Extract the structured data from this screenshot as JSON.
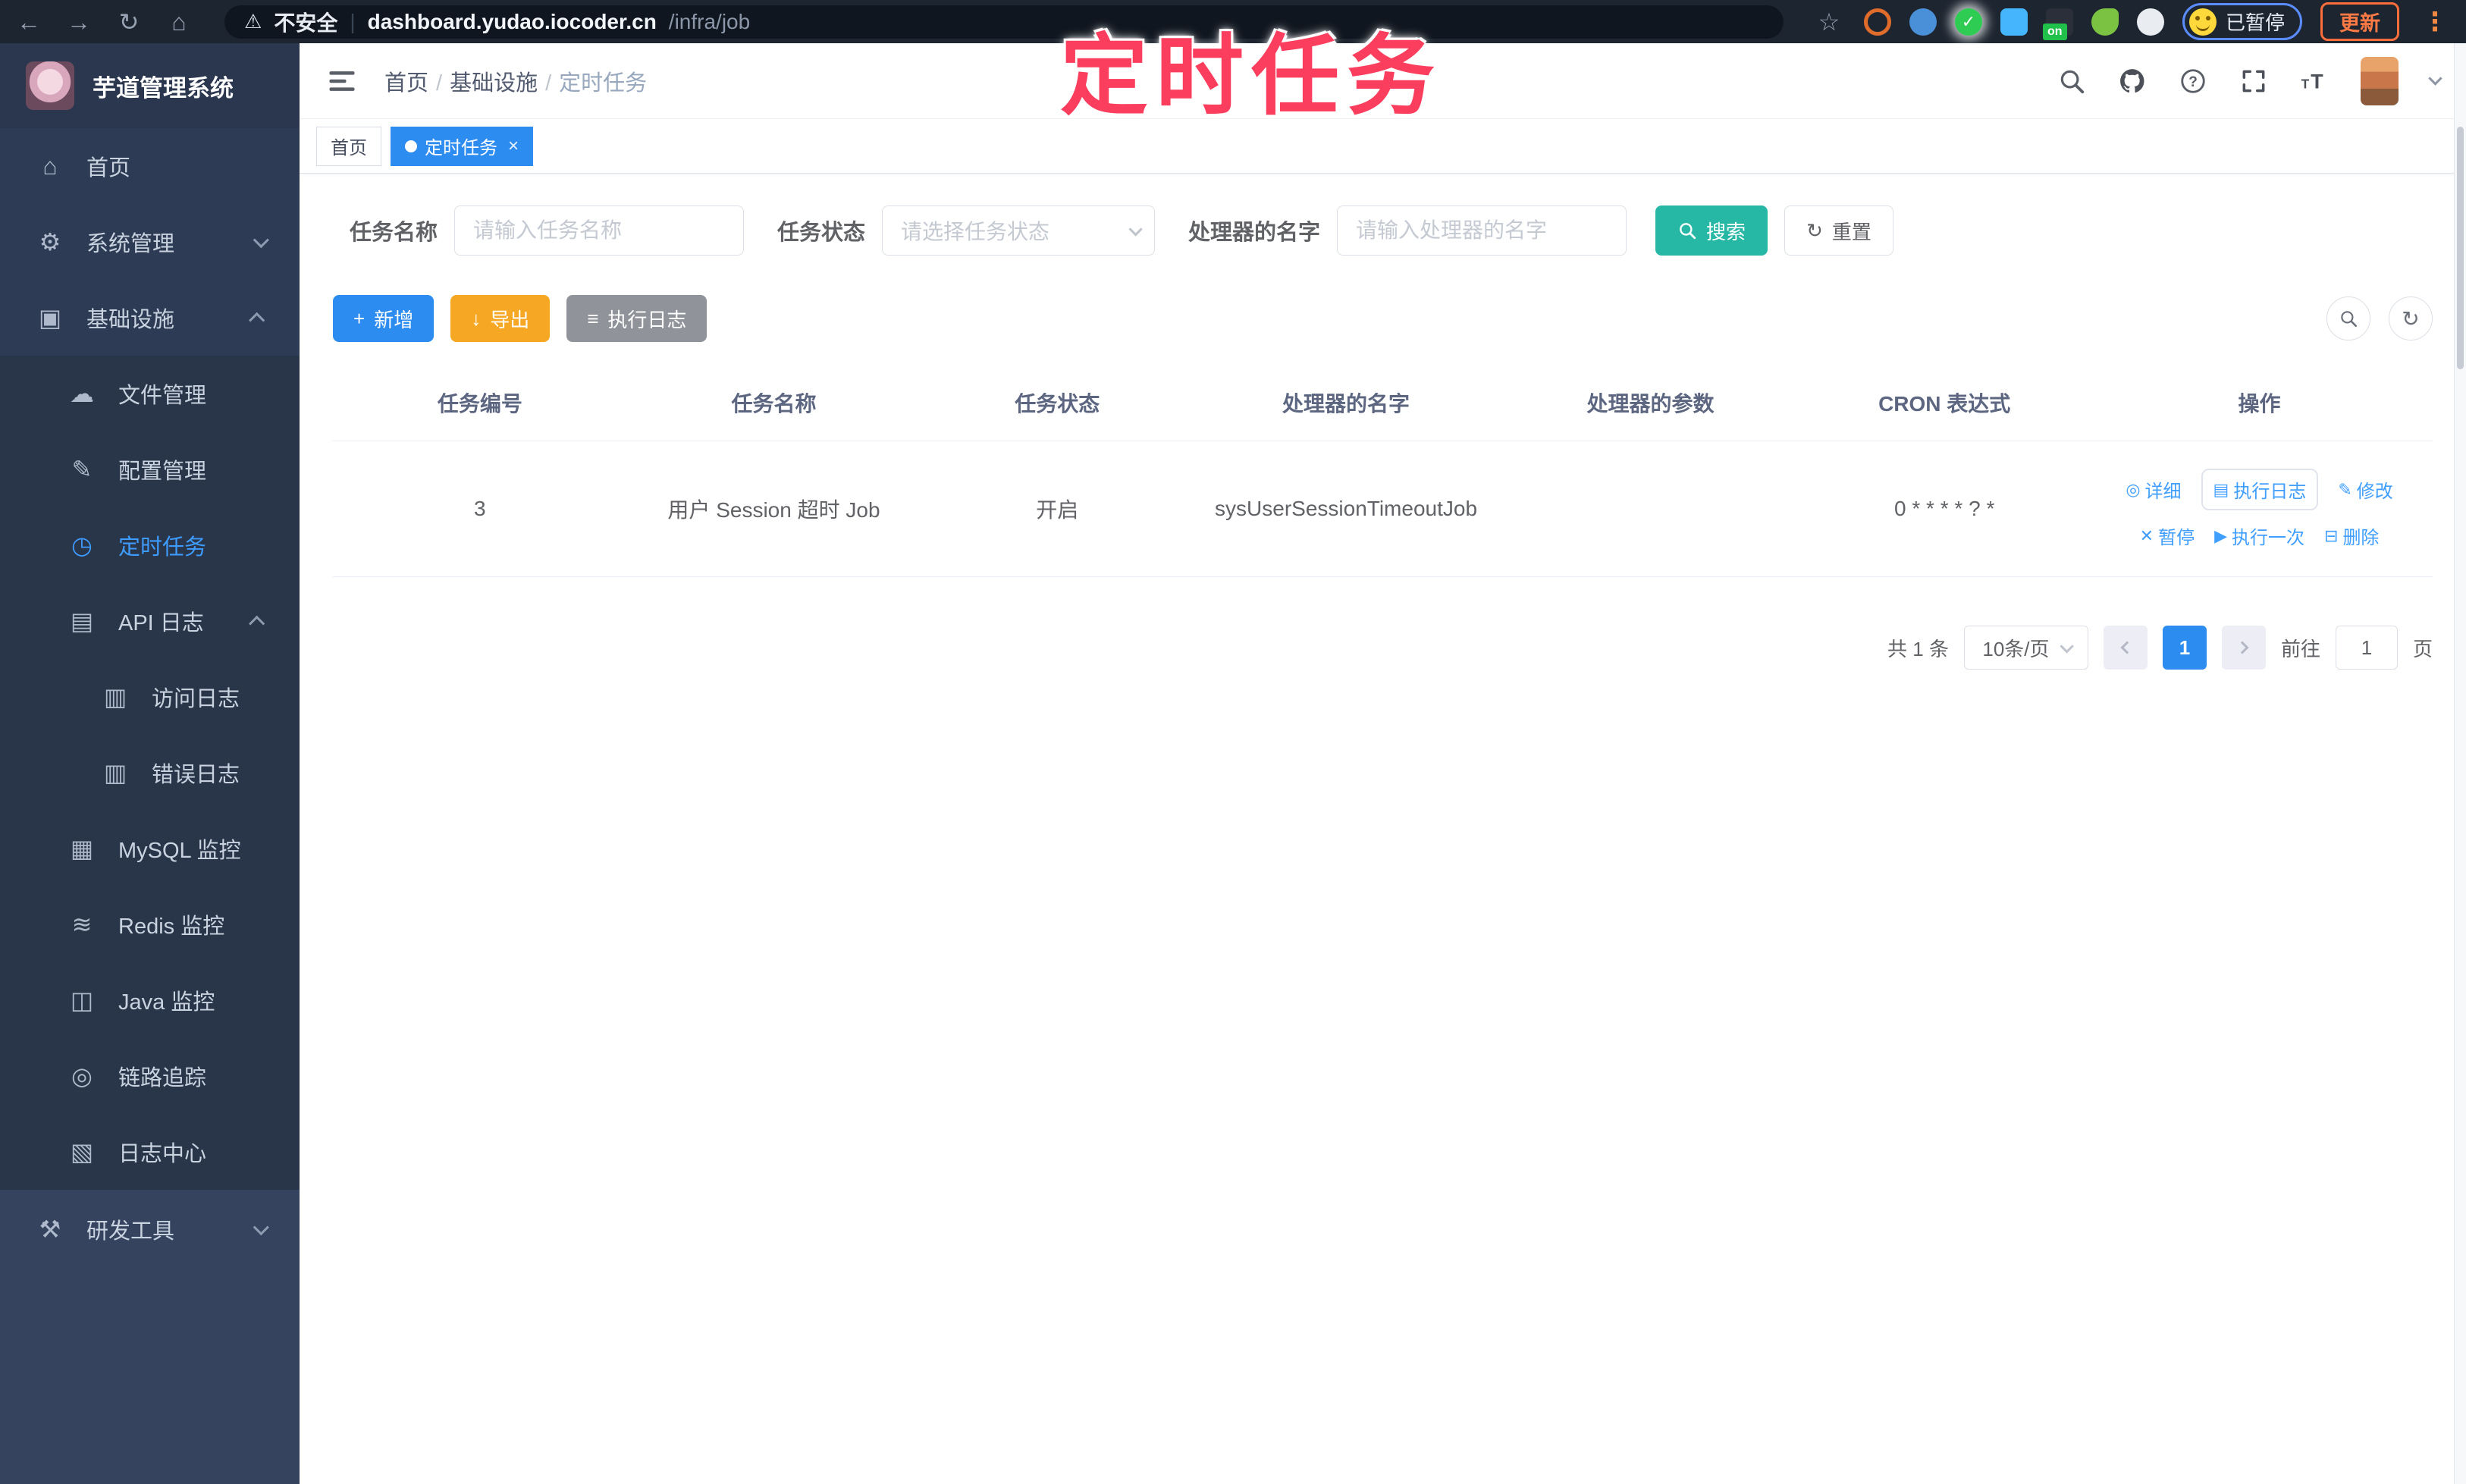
{
  "browser": {
    "security_label": "不安全",
    "url_host": "dashboard.yudao.iocoder.cn",
    "url_path": "/infra/job",
    "extension_on_badge": "on",
    "paused_label": "已暂停",
    "update_label": "更新"
  },
  "annotation": {
    "text": "定时任务",
    "color": "#fb3e5e"
  },
  "sidebar": {
    "title": "芋道管理系统",
    "items": [
      {
        "label": "首页",
        "icon": "home",
        "level": 1
      },
      {
        "label": "系统管理",
        "icon": "gear",
        "level": 1,
        "chevron": "down"
      },
      {
        "label": "基础设施",
        "icon": "infra",
        "level": 1,
        "chevron": "up"
      },
      {
        "label": "文件管理",
        "icon": "cloud-upload",
        "level": 2
      },
      {
        "label": "配置管理",
        "icon": "edit",
        "level": 2
      },
      {
        "label": "定时任务",
        "icon": "timer",
        "level": 2,
        "active": true
      },
      {
        "label": "API 日志",
        "icon": "api-log",
        "level": 2,
        "chevron": "up"
      },
      {
        "label": "访问日志",
        "icon": "doc",
        "level": 3
      },
      {
        "label": "错误日志",
        "icon": "doc",
        "level": 3
      },
      {
        "label": "MySQL 监控",
        "icon": "mysql",
        "level": 2
      },
      {
        "label": "Redis 监控",
        "icon": "redis",
        "level": 2
      },
      {
        "label": "Java 监控",
        "icon": "java",
        "level": 2
      },
      {
        "label": "链路追踪",
        "icon": "trace",
        "level": 2
      },
      {
        "label": "日志中心",
        "icon": "log-center",
        "level": 2
      },
      {
        "label": "研发工具",
        "icon": "tools",
        "level": 1,
        "chevron": "down"
      }
    ]
  },
  "header": {
    "breadcrumb": [
      "首页",
      "基础设施",
      "定时任务"
    ]
  },
  "tags": [
    {
      "label": "首页",
      "active": false
    },
    {
      "label": "定时任务",
      "active": true
    }
  ],
  "filters": {
    "task_name_label": "任务名称",
    "task_name_placeholder": "请输入任务名称",
    "task_status_label": "任务状态",
    "task_status_placeholder": "请选择任务状态",
    "handler_name_label": "处理器的名字",
    "handler_name_placeholder": "请输入处理器的名字",
    "search_label": "搜索",
    "reset_label": "重置"
  },
  "toolbar": {
    "add_label": "新增",
    "export_label": "导出",
    "exec_log_label": "执行日志"
  },
  "table": {
    "columns": [
      "任务编号",
      "任务名称",
      "任务状态",
      "处理器的名字",
      "处理器的参数",
      "CRON 表达式",
      "操作"
    ],
    "rows": [
      {
        "id": "3",
        "name": "用户 Session 超时 Job",
        "status": "开启",
        "handler": "sysUserSessionTimeoutJob",
        "params": "",
        "cron": "0 * * * * ? *",
        "actions": [
          {
            "icon": "view",
            "label": "详细",
            "focused": false
          },
          {
            "icon": "log",
            "label": "执行日志",
            "focused": true
          },
          {
            "icon": "pen",
            "label": "修改",
            "focused": false
          },
          {
            "icon": "close",
            "label": "暂停",
            "focused": false
          },
          {
            "icon": "play",
            "label": "执行一次",
            "focused": false
          },
          {
            "icon": "trash",
            "label": "删除",
            "focused": false
          }
        ]
      }
    ]
  },
  "pagination": {
    "total": "共 1 条",
    "page_size": "10条/页",
    "page": "1",
    "goto_label": "前往",
    "goto_value": "1",
    "page_unit": "页"
  },
  "colors": {
    "primary": "#2d8cf0",
    "link": "#409eff",
    "search_teal": "#26b8a5",
    "export_amber": "#f6a723",
    "info_gray": "#909399",
    "annotation_pink": "#fb3e5e"
  },
  "icons": {
    "back": "←",
    "forward": "→",
    "reload": "↻",
    "browser-home": "⌂",
    "warning": "⚠",
    "star": "☆",
    "kebab": "⋮",
    "check": "✓",
    "home": "⌂",
    "gear": "⚙",
    "infra": "▣",
    "cloud-upload": "☁",
    "edit": "✎",
    "timer": "◷",
    "api-log": "▤",
    "doc": "▥",
    "mysql": "▦",
    "redis": "≋",
    "java": "◫",
    "trace": "◎",
    "log-center": "▧",
    "tools": "⚒",
    "plus": "+",
    "download": "↓",
    "list": "≡",
    "refresh": "↻",
    "view": "◎",
    "log": "▤",
    "pen": "✎",
    "close": "✕",
    "play": "▶",
    "trash": "⊟",
    "close-x": "×"
  }
}
